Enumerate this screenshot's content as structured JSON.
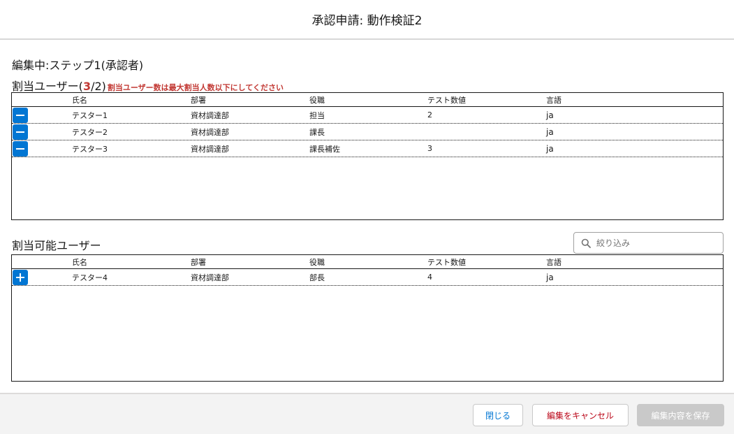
{
  "modal": {
    "title": "承認申請: 動作検証2"
  },
  "step": {
    "title": "編集中:ステップ1(承認者)"
  },
  "assigned": {
    "label_prefix": "割当ユーザー(",
    "count": "3",
    "label_suffix": "/2)",
    "error_message": "割当ユーザー数は最大割当人数以下にしてください",
    "columns": {
      "name": "氏名",
      "dept": "部署",
      "role": "役職",
      "num": "テスト数値",
      "lang": "言語"
    },
    "rows": [
      {
        "name": "テスター1",
        "dept": "資材調達部",
        "role": "担当",
        "num": "2",
        "lang": "ja"
      },
      {
        "name": "テスター2",
        "dept": "資材調達部",
        "role": "課長",
        "num": "",
        "lang": "ja"
      },
      {
        "name": "テスター3",
        "dept": "資材調達部",
        "role": "課長補佐",
        "num": "3",
        "lang": "ja"
      }
    ]
  },
  "available": {
    "title": "割当可能ユーザー",
    "filter_placeholder": "絞り込み",
    "columns": {
      "name": "氏名",
      "dept": "部署",
      "role": "役職",
      "num": "テスト数値",
      "lang": "言語"
    },
    "rows": [
      {
        "name": "テスター4",
        "dept": "資材調達部",
        "role": "部長",
        "num": "4",
        "lang": "ja"
      }
    ]
  },
  "footer": {
    "close_label": "閉じる",
    "cancel_label": "編集をキャンセル",
    "save_label": "編集内容を保存"
  },
  "colors": {
    "brand": "#0176d3",
    "error": "#ba0517",
    "disabled": "#c9c9c9"
  },
  "icons": {
    "remove": "minus-icon",
    "add": "plus-icon",
    "search": "search-icon"
  }
}
